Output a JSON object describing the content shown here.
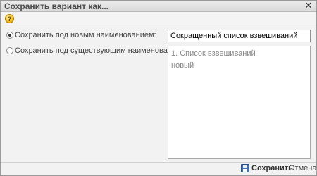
{
  "window": {
    "title": "Сохранить вариант как...",
    "close_symbol": "✕"
  },
  "toolbar": {
    "help_symbol": "?"
  },
  "options": {
    "new_name": {
      "label": "Сохранить под новым наименованием:",
      "checked": true
    },
    "existing_name": {
      "label": "Сохранить под существующим наименованием:",
      "checked": false
    }
  },
  "name_input": {
    "value": "Сокращенный список взвешиваний"
  },
  "existing_variants": {
    "items": [
      "1. Список взвешиваний",
      "новый"
    ]
  },
  "footer": {
    "save_label": "Сохранить",
    "cancel_label": "Отмена"
  },
  "icons": {
    "help": "help-icon",
    "close": "close-icon",
    "save": "floppy-disk-icon"
  }
}
